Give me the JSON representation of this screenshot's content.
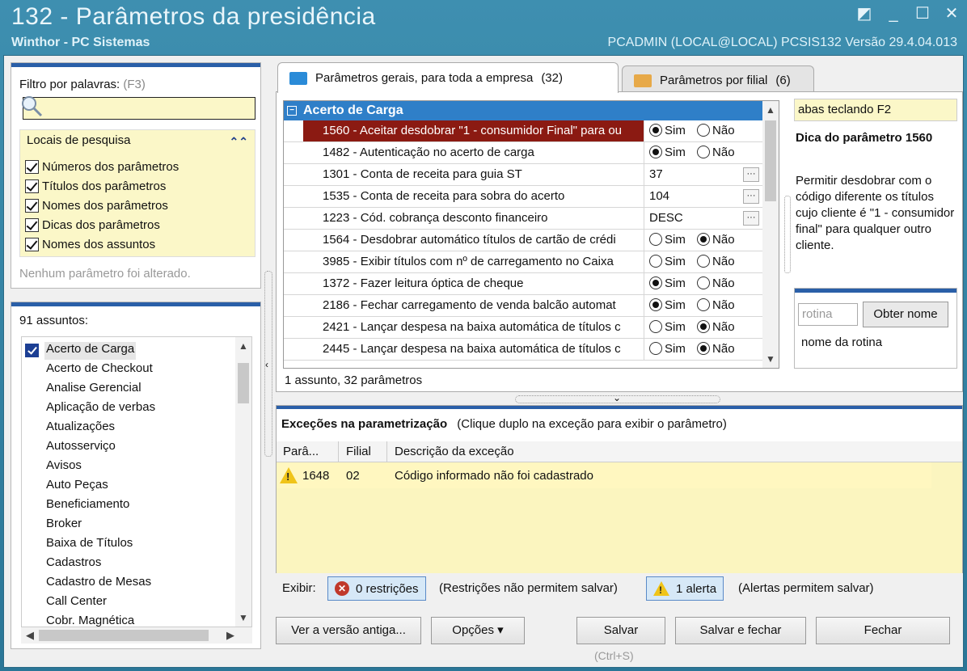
{
  "window": {
    "title": "132 - Parâmetros da presidência",
    "subtitle": "Winthor - PC Sistemas",
    "user_info": "PCADMIN (LOCAL@LOCAL)   PCSIS132  Versão  29.4.04.013",
    "controls": [
      "restore-icon",
      "minimize-icon",
      "maximize-icon",
      "close-icon"
    ]
  },
  "filter": {
    "label": "Filtro por palavras:",
    "shortcut": "(F3)",
    "value": "",
    "locais_title": "Locais de pesquisa",
    "options": [
      {
        "label": "Números dos parâmetros",
        "checked": true
      },
      {
        "label": "Títulos dos parâmetros",
        "checked": true
      },
      {
        "label": "Nomes dos parâmetros",
        "checked": true
      },
      {
        "label": "Dicas dos parâmetros",
        "checked": true
      },
      {
        "label": "Nomes dos assuntos",
        "checked": true
      }
    ],
    "status": "Nenhum parâmetro foi alterado."
  },
  "assuntos": {
    "count_label": "91 assuntos:",
    "items": [
      "Acerto de Carga",
      "Acerto de Checkout",
      "Analise Gerencial",
      "Aplicação de verbas",
      "Atualizações",
      "Autosserviço",
      "Avisos",
      "Auto Peças",
      "Beneficiamento",
      "Broker",
      "Baixa de Títulos",
      "Cadastros",
      "Cadastro de Mesas",
      "Call Center",
      "Cobr. Magnética"
    ],
    "selected_index": 0
  },
  "tabs": [
    {
      "label": "Parâmetros gerais, para toda a empresa",
      "count": "(32)",
      "active": true
    },
    {
      "label": "Parâmetros por filial",
      "count": "(6)",
      "active": false
    }
  ],
  "grid": {
    "group": "Acerto de Carga",
    "rows": [
      {
        "name": "1560 - Aceitar desdobrar \"1 - consumidor Final\" para ou",
        "type": "radio",
        "value": "Sim",
        "selected": true
      },
      {
        "name": "1482 - Autenticação no acerto de carga",
        "type": "radio",
        "value": "Sim"
      },
      {
        "name": "1301 - Conta de receita para guia ST",
        "type": "text",
        "value": "37"
      },
      {
        "name": "1535 - Conta de receita para sobra do acerto",
        "type": "text",
        "value": "104"
      },
      {
        "name": "1223 - Cód. cobrança desconto financeiro",
        "type": "text",
        "value": "DESC"
      },
      {
        "name": "1564 - Desdobrar automático títulos de cartão de crédi",
        "type": "radio",
        "value": "Não"
      },
      {
        "name": "3985 - Exibir títulos com nº de carregamento no Caixa",
        "type": "radio",
        "value": "none"
      },
      {
        "name": "1372 - Fazer leitura óptica de cheque",
        "type": "radio",
        "value": "Sim"
      },
      {
        "name": "2186 - Fechar carregamento de venda balcão automat",
        "type": "radio",
        "value": "Sim"
      },
      {
        "name": "2421 - Lançar despesa na baixa automática de títulos c",
        "type": "radio",
        "value": "Não"
      },
      {
        "name": "2445 - Lançar despesa na baixa automática de títulos c",
        "type": "radio",
        "value": "Não"
      }
    ],
    "sim_label": "Sim",
    "nao_label": "Não",
    "ellipsis": "···",
    "status": "1 assunto, 32 parâmetros"
  },
  "tip": {
    "hint_box": "abas teclando F2",
    "title": "Dica do parâmetro 1560",
    "body": "Permitir desdobrar com o código diferente os títulos cujo cliente é \"1 - consumidor final\" para qualquer outro cliente.",
    "rotina_placeholder": "rotina",
    "obter_label": "Obter nome",
    "rotina_label": "nome da rotina"
  },
  "excecoes": {
    "title": "Exceções na parametrização",
    "subtitle": "(Clique duplo na exceção para exibir o parâmetro)",
    "columns": [
      "Parâ...",
      "Filial",
      "Descrição da exceção"
    ],
    "rows": [
      {
        "param": "1648",
        "filial": "02",
        "descricao": "Código informado não foi cadastrado"
      }
    ]
  },
  "exibir": {
    "label": "Exibir:",
    "restricoes": "0 restrições",
    "restricoes_note": "(Restrições não permitem salvar)",
    "alertas": "1 alerta",
    "alertas_note": "(Alertas permitem salvar)"
  },
  "buttons": {
    "versao_antiga": "Ver a versão antiga...",
    "opcoes": "Opções ▾",
    "salvar": "Salvar",
    "salvar_shortcut": "(Ctrl+S)",
    "salvar_fechar": "Salvar e fechar",
    "fechar": "Fechar"
  },
  "colors": {
    "title_bar": "#3e8fb0",
    "group_header": "#2f7fc8",
    "selected_row": "#8b1a12",
    "highlight_yellow": "#fbf7c8"
  }
}
